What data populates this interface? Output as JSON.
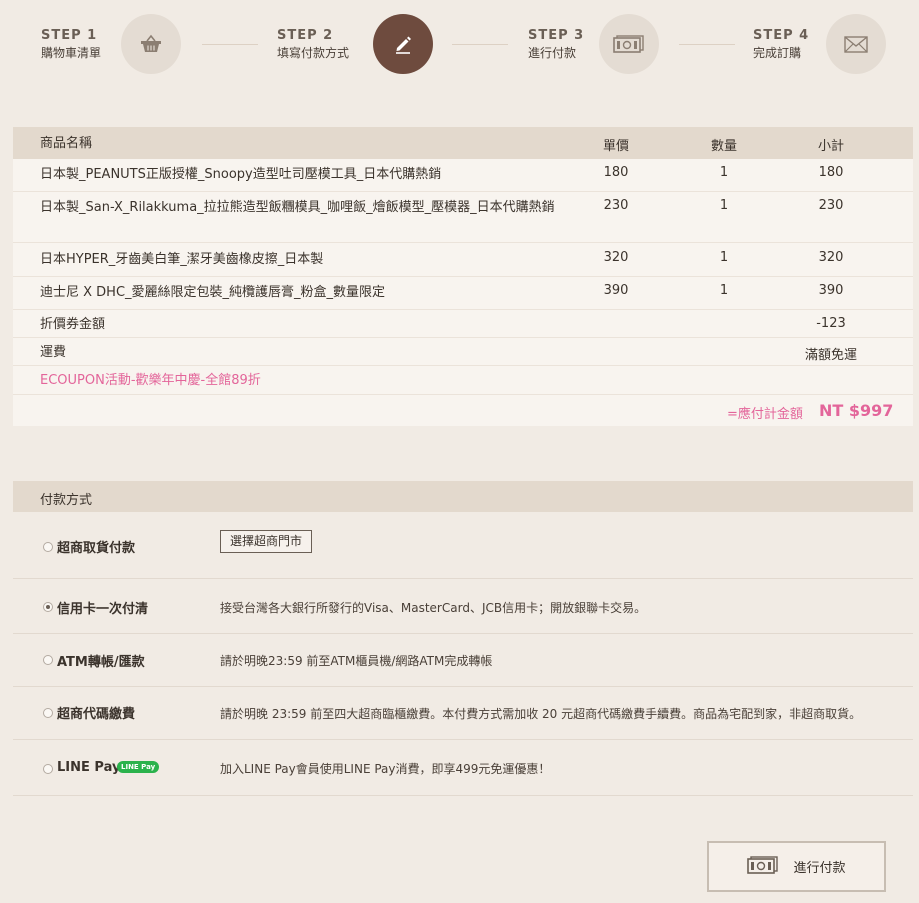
{
  "steps": [
    {
      "num": "STEP 1",
      "name": "購物車清單",
      "icon": "basket-icon"
    },
    {
      "num": "STEP 2",
      "name": "填寫付款方式",
      "icon": "pencil-icon"
    },
    {
      "num": "STEP 3",
      "name": "進行付款",
      "icon": "cash-icon"
    },
    {
      "num": "STEP 4",
      "name": "完成訂購",
      "icon": "envelope-icon"
    }
  ],
  "cart": {
    "headers": {
      "name": "商品名稱",
      "price": "單價",
      "qty": "數量",
      "subtotal": "小計"
    },
    "items": [
      {
        "name": "日本製_PEANUTS正版授權_Snoopy造型吐司壓模工具_日本代購熱銷",
        "price": "180",
        "qty": "1",
        "subtotal": "180"
      },
      {
        "name": "日本製_San-X_Rilakkuma_拉拉熊造型飯糰模具_咖哩飯_燴飯模型_壓模器_日本代購熱銷",
        "price": "230",
        "qty": "1",
        "subtotal": "230"
      },
      {
        "name": "日本HYPER_牙齒美白筆_潔牙美齒橡皮擦_日本製",
        "price": "320",
        "qty": "1",
        "subtotal": "320"
      },
      {
        "name": "迪士尼 X DHC_愛麗絲限定包裝_純欖護唇膏_粉盒_數量限定",
        "price": "390",
        "qty": "1",
        "subtotal": "390"
      }
    ],
    "coupon_label": "折價券金額",
    "coupon_value": "-123",
    "shipping_label": "運費",
    "shipping_value": "滿額免運",
    "promo": "ECOUPON活動-歡樂年中慶-全館89折",
    "total_label": "=應付計金額",
    "total_value": "NT $997"
  },
  "payment": {
    "title": "付款方式",
    "store_button": "選擇超商門市",
    "methods": [
      {
        "label": "超商取貨付款",
        "desc": "",
        "selected": false
      },
      {
        "label": "信用卡一次付清",
        "desc": "接受台灣各大銀行所發行的Visa、MasterCard、JCB信用卡；開放銀聯卡交易。",
        "selected": true
      },
      {
        "label": "ATM轉帳/匯款",
        "desc": "請於明晚23:59 前至ATM櫃員機/網路ATM完成轉帳",
        "selected": false
      },
      {
        "label": "超商代碼繳費",
        "desc": "請於明晚 23:59 前至四大超商臨櫃繳費。本付費方式需加收 20 元超商代碼繳費手續費。商品為宅配到家，非超商取貨。",
        "selected": false
      },
      {
        "label": "LINE Pay",
        "desc": "加入LINE Pay會員使用LINE Pay消費，即享499元免運優惠！",
        "selected": false
      }
    ],
    "linepay_badge": "LINE Pay"
  },
  "submit": {
    "label": "進行付款",
    "icon": "cash-icon"
  },
  "colors": {
    "accent": "#6e4b3e",
    "pink": "#e3659a",
    "background": "#f1ebe4"
  }
}
